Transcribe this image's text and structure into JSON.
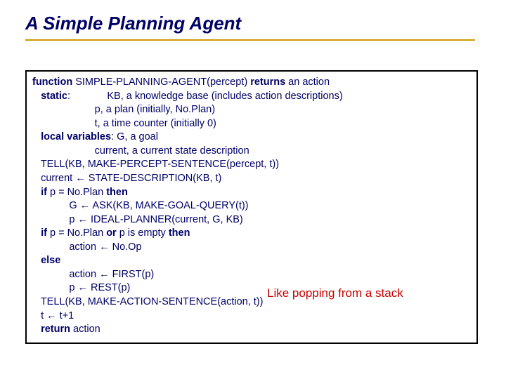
{
  "title": "A Simple Planning Agent",
  "code": {
    "l1a": "function",
    "l1b": " SIMPLE-PLANNING-AGENT(percept) ",
    "l1c": "returns",
    "l1d": " an action",
    "l2a": "   static",
    "l2b": ":             KB, a knowledge base (includes action descriptions)",
    "l3": "                      p, a plan (initially, No.Plan)",
    "l4": "                      t, a time counter (initially 0)",
    "l5a": "   local variables",
    "l5b": ": G, a goal",
    "l6": "                      current, a current state description",
    "l7": "   TELL(KB, MAKE-PERCEPT-SENTENCE(percept, t))",
    "l8": "   current ← STATE-DESCRIPTION(KB, t)",
    "l9a": "   if",
    "l9b": " p = No.Plan ",
    "l9c": "then",
    "l10": "             G ← ASK(KB, MAKE-GOAL-QUERY(t))",
    "l11": "             p ← IDEAL-PLANNER(current, G, KB)",
    "l12a": "   if",
    "l12b": " p = No.Plan ",
    "l12c": "or",
    "l12d": " p is empty ",
    "l12e": "then",
    "l13": "             action ← No.Op",
    "l14": "   else",
    "l15": "             action ← FIRST(p)",
    "l16": "             p ← REST(p)",
    "l17": "   TELL(KB, MAKE-ACTION-SENTENCE(action, t))",
    "l18": "   t ← t+1",
    "l19a": "   return",
    "l19b": " action"
  },
  "annotation": "Like popping from a stack"
}
